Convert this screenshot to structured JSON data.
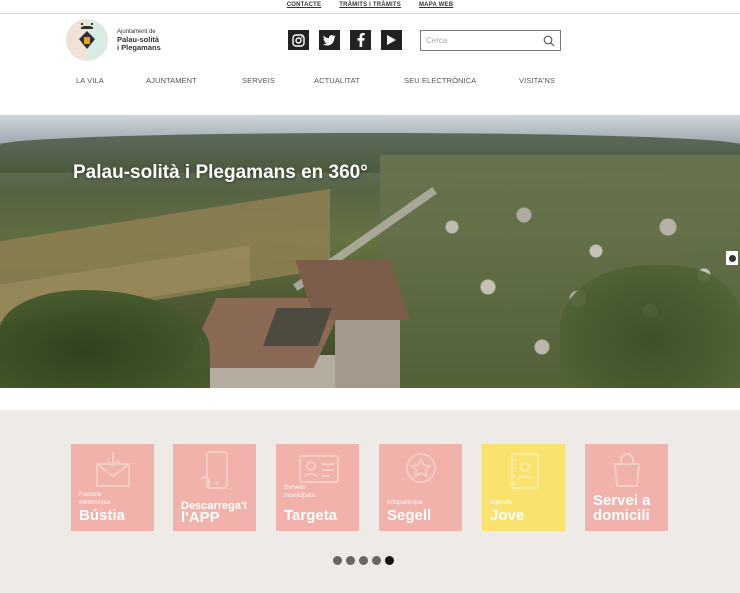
{
  "topbar": {
    "links": [
      "CONTACTE",
      "TRÀMITS I TRÀMITS",
      "MAPA WEB"
    ]
  },
  "logo": {
    "line1": "Ajuntament de",
    "line2": "Palau-solità",
    "line3": "i Plegamans"
  },
  "social": {
    "icons": [
      "instagram-icon",
      "twitter-icon",
      "facebook-icon",
      "youtube-icon"
    ]
  },
  "search": {
    "placeholder": "Cerca"
  },
  "nav": {
    "items": [
      "LA VILA",
      "AJUNTAMENT",
      "SERVEIS",
      "ACTUALITAT",
      "SEU ELECTRÒNICA",
      "VISITA'NS"
    ]
  },
  "hero": {
    "title": "Palau-solità i Plegamans en 360°"
  },
  "tiles": [
    {
      "small1": "Factura",
      "small2": "electrònica",
      "big1": "Bústia",
      "big2": "",
      "color": "#f0b2aa"
    },
    {
      "small1": "",
      "small2": "",
      "big1": "Descarrega't",
      "big2": "l'APP",
      "color": "#f0b2aa"
    },
    {
      "small1": "Serveis",
      "small2": "municipals",
      "big1": "Targeta",
      "big2": "",
      "color": "#f0b2aa"
    },
    {
      "small1": "",
      "small2": "Infoparticipa",
      "big1": "Segell",
      "big2": "",
      "color": "#f0b2aa"
    },
    {
      "small1": "",
      "small2": "agenda",
      "big1": "Jove",
      "big2": "",
      "color": "#f9e36e"
    },
    {
      "small1": "",
      "small2": "",
      "big1": "Servei a",
      "big2": "domicili",
      "color": "#f0b2aa"
    }
  ],
  "carousel": {
    "dot_count": 5,
    "active_index": 4
  }
}
